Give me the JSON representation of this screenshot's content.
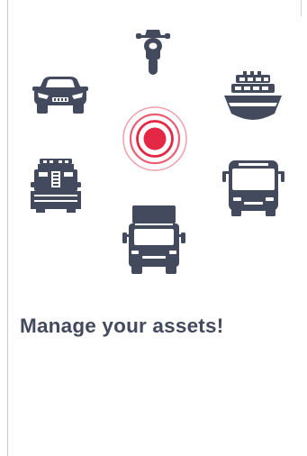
{
  "onboarding": {
    "headline": "Manage your assets!"
  },
  "colors": {
    "background": "#ffffff",
    "vehicle_icons": "#434a5e",
    "tracker_accent": "#e32744",
    "headline_text": "#434a5e"
  },
  "icons": {
    "motorcycle": "motorcycle-icon",
    "car": "car-icon",
    "ship": "ship-icon",
    "tractor": "tractor-icon",
    "bus": "bus-icon",
    "truck": "truck-icon",
    "tracker": "location-signal-icon"
  }
}
